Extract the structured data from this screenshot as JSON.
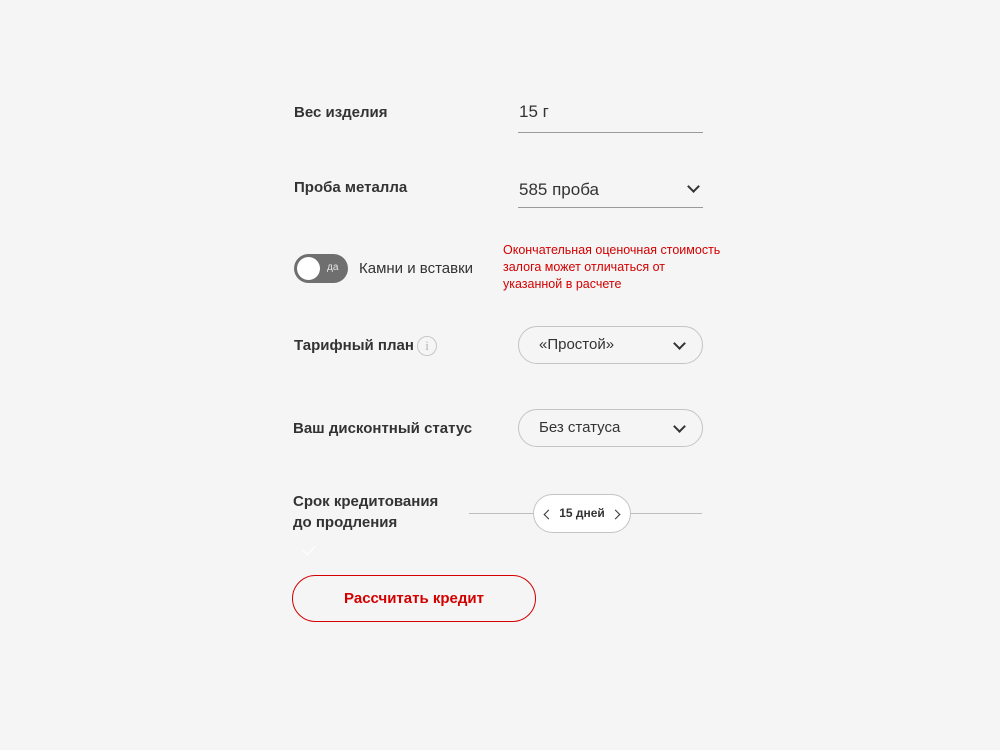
{
  "weight": {
    "label": "Вес изделия",
    "value": "15 г"
  },
  "metal_purity": {
    "label": "Проба металла",
    "value": "585 проба"
  },
  "stones": {
    "toggle_text": "да",
    "label": "Камни и вставки",
    "warning": "Окончательная оценочная стоимость залога может отличаться от указанной в расчете"
  },
  "tariff": {
    "label": "Тарифный план",
    "info_glyph": "i",
    "value": "«Простой»"
  },
  "discount": {
    "label": "Ваш дисконтный статус",
    "value": "Без статуса"
  },
  "term": {
    "label_line1": "Срок кредитования",
    "label_line2": "до продления",
    "value": "15 дней"
  },
  "actions": {
    "calculate_label": "Рассчитать кредит"
  },
  "colors": {
    "accent": "#d40000",
    "background": "#f5f5f5",
    "toggle_track": "#6f6f6f"
  },
  "icons": [
    "chevron-down-icon",
    "info-icon",
    "chevron-left-icon",
    "chevron-right-icon",
    "check-icon"
  ]
}
